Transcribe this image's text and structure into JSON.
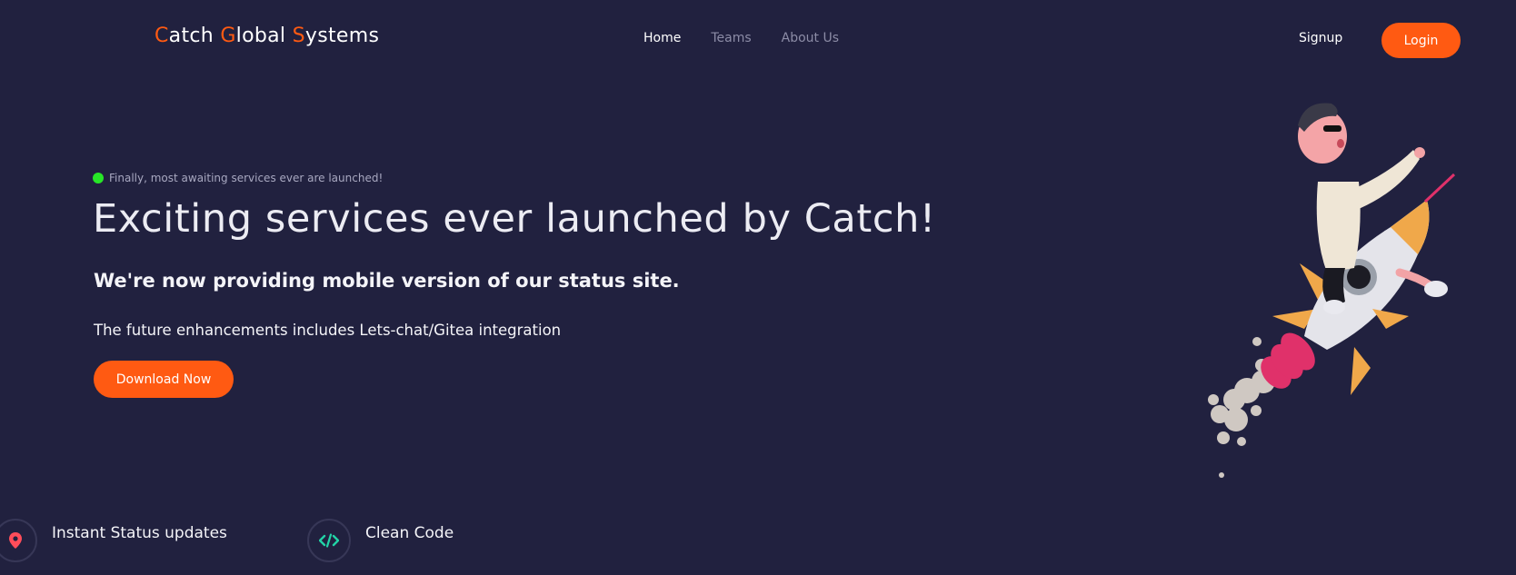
{
  "header": {
    "brand": {
      "letter1": "C",
      "rest1": "atch ",
      "letter2": "G",
      "rest2": "lobal ",
      "letter3": "S",
      "rest3": "ystems"
    },
    "nav": [
      {
        "label": "Home",
        "active": true
      },
      {
        "label": "Teams",
        "active": false
      },
      {
        "label": "About Us",
        "active": false
      }
    ],
    "signup_label": "Signup",
    "login_label": "Login"
  },
  "hero": {
    "badge_text": "Finally, most awaiting services ever are launched!",
    "title": "Exciting services ever launched by Catch!",
    "subtitle": "We're now providing mobile version of our status site.",
    "note": "The future enhancements includes Lets-chat/Gitea integration",
    "cta_label": "Download Now"
  },
  "features": [
    {
      "label": "Instant Status updates",
      "icon": "map-pin-icon",
      "color": "#ff4d5a"
    },
    {
      "label": "Clean Code",
      "icon": "code-icon",
      "color": "#22d3a6"
    }
  ],
  "colors": {
    "background": "#21213f",
    "accent": "#ff5a12",
    "status_dot": "#27e627"
  }
}
